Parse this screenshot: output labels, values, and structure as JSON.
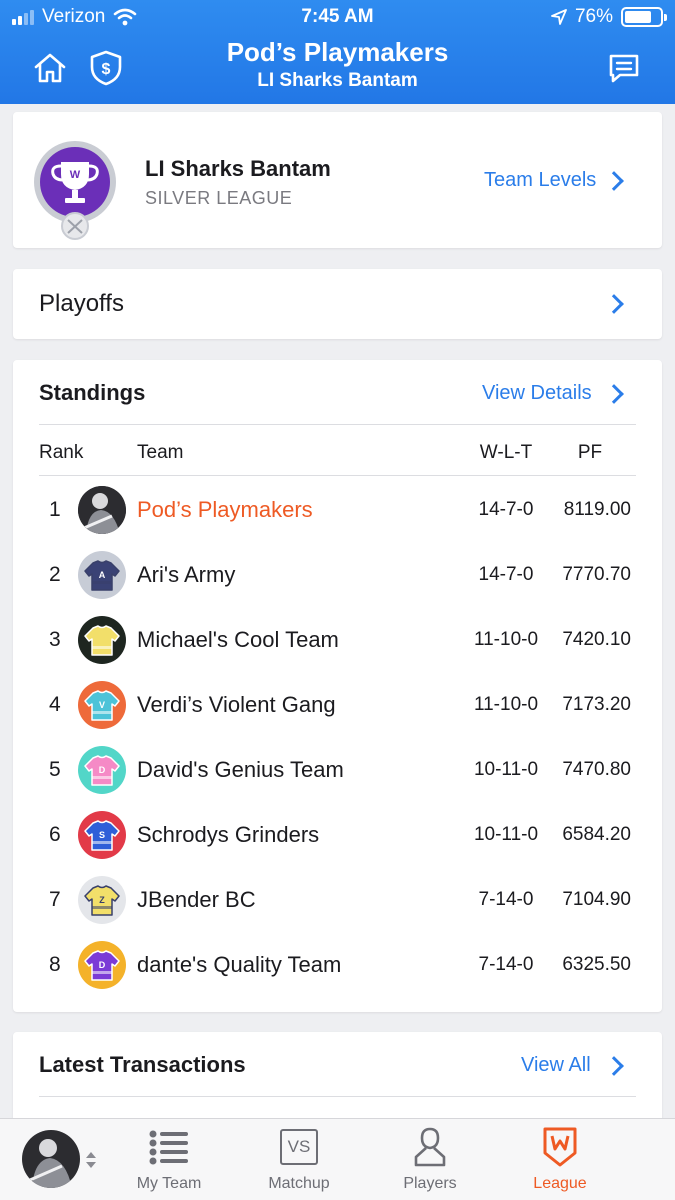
{
  "status": {
    "carrier": "Verizon",
    "time": "7:45 AM",
    "battery": "76%"
  },
  "header": {
    "title": "Pod’s Playmakers",
    "subtitle": "LI Sharks Bantam"
  },
  "league_card": {
    "league_title": "LI Sharks Bantam",
    "level": "SILVER LEAGUE",
    "link": "Team Levels"
  },
  "playoffs": {
    "label": "Playoffs"
  },
  "standings": {
    "title": "Standings",
    "link": "View Details",
    "columns": {
      "rank": "Rank",
      "team": "Team",
      "wlt": "W-L-T",
      "pf": "PF"
    },
    "rows": [
      {
        "rank": "1",
        "team": "Pod’s Playmakers",
        "wlt": "14-7-0",
        "pf": "8119.00",
        "color": "#3a3a3a",
        "letter": ""
      },
      {
        "rank": "2",
        "team": "Ari's Army",
        "wlt": "14-7-0",
        "pf": "7770.70",
        "color": "#c7ccd6",
        "letter": "A"
      },
      {
        "rank": "3",
        "team": "Michael's Cool Team",
        "wlt": "11-10-0",
        "pf": "7420.10",
        "color": "#1e2620",
        "letter": ""
      },
      {
        "rank": "4",
        "team": "Verdi’s Violent Gang",
        "wlt": "11-10-0",
        "pf": "7173.20",
        "color": "#ee6a3a",
        "letter": "V"
      },
      {
        "rank": "5",
        "team": "David's Genius Team",
        "wlt": "10-11-0",
        "pf": "7470.80",
        "color": "#52d6c8",
        "letter": "D"
      },
      {
        "rank": "6",
        "team": "Schrodys Grinders",
        "wlt": "10-11-0",
        "pf": "6584.20",
        "color": "#e23a48",
        "letter": "S"
      },
      {
        "rank": "7",
        "team": "JBender BC",
        "wlt": "7-14-0",
        "pf": "7104.90",
        "color": "#e4e6ea",
        "letter": "Z"
      },
      {
        "rank": "8",
        "team": "dante's Quality Team",
        "wlt": "7-14-0",
        "pf": "6325.50",
        "color": "#f4b22a",
        "letter": "D"
      }
    ]
  },
  "transactions": {
    "title": "Latest Transactions",
    "link": "View All"
  },
  "nav": {
    "my_team": "My Team",
    "matchup": "Matchup",
    "matchup_icon_text": "VS",
    "players": "Players",
    "league": "League"
  },
  "colors": {
    "header_blue": "#2b7de9",
    "accent_orange": "#ee5a24"
  }
}
